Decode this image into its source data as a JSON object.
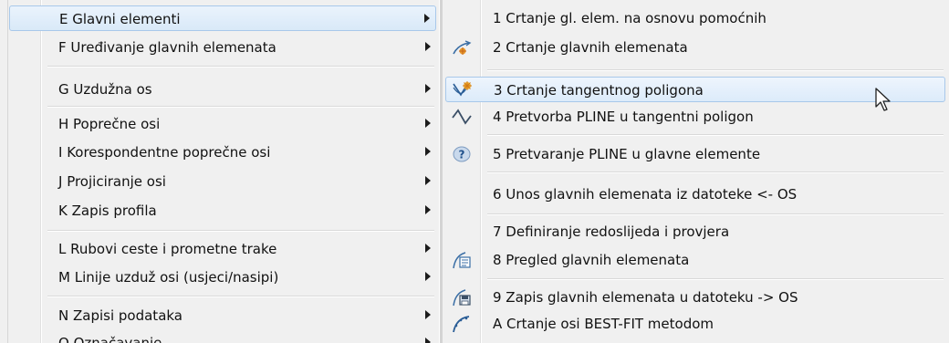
{
  "left_menu": {
    "items": [
      {
        "label": "E Glavni elementi",
        "submenu": true,
        "state": "active"
      },
      {
        "label": "F Uređivanje glavnih elemenata",
        "submenu": true
      },
      {
        "label": "G Uzdužna os",
        "submenu": true
      },
      {
        "label": "H Poprečne osi",
        "submenu": true
      },
      {
        "label": "I Korespondentne poprečne osi",
        "submenu": true
      },
      {
        "label": "J Projiciranje osi",
        "submenu": true
      },
      {
        "label": "K Zapis profila",
        "submenu": true
      },
      {
        "label": "L Rubovi ceste i prometne trake",
        "submenu": true
      },
      {
        "label": "M Linije uzduž osi (usjeci/nasipi)",
        "submenu": true
      },
      {
        "label": "N Zapisi podataka",
        "submenu": true
      },
      {
        "label": "O Označavanje",
        "submenu": true
      }
    ]
  },
  "sub_menu": {
    "items": [
      {
        "label": "1 Crtanje gl. elem. na osnovu pomoćnih",
        "icon": "none"
      },
      {
        "label": "2 Crtanje glavnih elemenata",
        "icon": "draw-elements-icon"
      },
      {
        "label": "3 Crtanje tangentnog poligona",
        "icon": "tangent-polygon-icon",
        "state": "hovered"
      },
      {
        "label": "4 Pretvorba PLINE u tangentni poligon",
        "icon": "pline-to-polygon-icon"
      },
      {
        "label": "5 Pretvaranje PLINE u glavne elemente",
        "icon": "help-question-icon"
      },
      {
        "label": "6 Unos glavnih elemenata iz datoteke <- OS",
        "icon": "none"
      },
      {
        "label": "7 Definiranje redoslijeda i provjera",
        "icon": "none"
      },
      {
        "label": "8 Pregled glavnih elemenata",
        "icon": "review-elements-icon"
      },
      {
        "label": "9 Zapis glavnih elemenata u datoteku -> OS",
        "icon": "save-elements-icon"
      },
      {
        "label": "A Crtanje osi BEST-FIT metodom",
        "icon": "best-fit-curve-icon"
      }
    ]
  },
  "colors": {
    "menu_bg": "#f0f0f0",
    "highlight_border": "#a8c8ea",
    "highlight_fill": "#dcebfa"
  },
  "cursor": {
    "icon": "mouse-pointer-icon"
  }
}
